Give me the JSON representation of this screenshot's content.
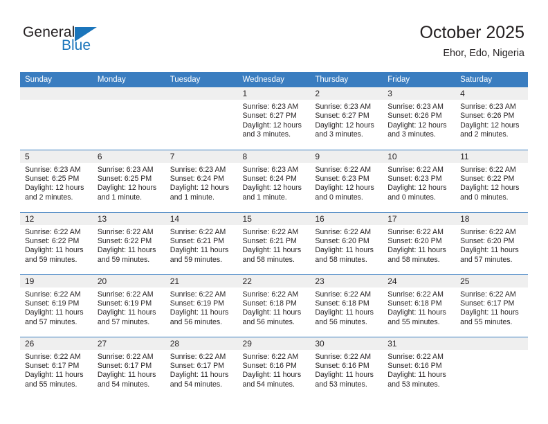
{
  "brand": {
    "name_top": "General",
    "name_bottom": "Blue",
    "accent_color": "#1b75bb"
  },
  "header": {
    "title": "October 2025",
    "location": "Ehor, Edo, Nigeria"
  },
  "theme": {
    "header_row_color": "#3a7dc0",
    "daynum_band_color": "#efefef",
    "text_color": "#231f20"
  },
  "weekdays": [
    "Sunday",
    "Monday",
    "Tuesday",
    "Wednesday",
    "Thursday",
    "Friday",
    "Saturday"
  ],
  "labels": {
    "sunrise_prefix": "Sunrise:",
    "sunset_prefix": "Sunset:",
    "daylight_prefix": "Daylight:"
  },
  "weeks": [
    [
      {
        "day": "",
        "empty": true
      },
      {
        "day": "",
        "empty": true
      },
      {
        "day": "",
        "empty": true
      },
      {
        "day": "1",
        "sunrise": "Sunrise: 6:23 AM",
        "sunset": "Sunset: 6:27 PM",
        "daylight": "Daylight: 12 hours and 3 minutes."
      },
      {
        "day": "2",
        "sunrise": "Sunrise: 6:23 AM",
        "sunset": "Sunset: 6:27 PM",
        "daylight": "Daylight: 12 hours and 3 minutes."
      },
      {
        "day": "3",
        "sunrise": "Sunrise: 6:23 AM",
        "sunset": "Sunset: 6:26 PM",
        "daylight": "Daylight: 12 hours and 3 minutes."
      },
      {
        "day": "4",
        "sunrise": "Sunrise: 6:23 AM",
        "sunset": "Sunset: 6:26 PM",
        "daylight": "Daylight: 12 hours and 2 minutes."
      }
    ],
    [
      {
        "day": "5",
        "sunrise": "Sunrise: 6:23 AM",
        "sunset": "Sunset: 6:25 PM",
        "daylight": "Daylight: 12 hours and 2 minutes."
      },
      {
        "day": "6",
        "sunrise": "Sunrise: 6:23 AM",
        "sunset": "Sunset: 6:25 PM",
        "daylight": "Daylight: 12 hours and 1 minute."
      },
      {
        "day": "7",
        "sunrise": "Sunrise: 6:23 AM",
        "sunset": "Sunset: 6:24 PM",
        "daylight": "Daylight: 12 hours and 1 minute."
      },
      {
        "day": "8",
        "sunrise": "Sunrise: 6:23 AM",
        "sunset": "Sunset: 6:24 PM",
        "daylight": "Daylight: 12 hours and 1 minute."
      },
      {
        "day": "9",
        "sunrise": "Sunrise: 6:22 AM",
        "sunset": "Sunset: 6:23 PM",
        "daylight": "Daylight: 12 hours and 0 minutes."
      },
      {
        "day": "10",
        "sunrise": "Sunrise: 6:22 AM",
        "sunset": "Sunset: 6:23 PM",
        "daylight": "Daylight: 12 hours and 0 minutes."
      },
      {
        "day": "11",
        "sunrise": "Sunrise: 6:22 AM",
        "sunset": "Sunset: 6:22 PM",
        "daylight": "Daylight: 12 hours and 0 minutes."
      }
    ],
    [
      {
        "day": "12",
        "sunrise": "Sunrise: 6:22 AM",
        "sunset": "Sunset: 6:22 PM",
        "daylight": "Daylight: 11 hours and 59 minutes."
      },
      {
        "day": "13",
        "sunrise": "Sunrise: 6:22 AM",
        "sunset": "Sunset: 6:22 PM",
        "daylight": "Daylight: 11 hours and 59 minutes."
      },
      {
        "day": "14",
        "sunrise": "Sunrise: 6:22 AM",
        "sunset": "Sunset: 6:21 PM",
        "daylight": "Daylight: 11 hours and 59 minutes."
      },
      {
        "day": "15",
        "sunrise": "Sunrise: 6:22 AM",
        "sunset": "Sunset: 6:21 PM",
        "daylight": "Daylight: 11 hours and 58 minutes."
      },
      {
        "day": "16",
        "sunrise": "Sunrise: 6:22 AM",
        "sunset": "Sunset: 6:20 PM",
        "daylight": "Daylight: 11 hours and 58 minutes."
      },
      {
        "day": "17",
        "sunrise": "Sunrise: 6:22 AM",
        "sunset": "Sunset: 6:20 PM",
        "daylight": "Daylight: 11 hours and 58 minutes."
      },
      {
        "day": "18",
        "sunrise": "Sunrise: 6:22 AM",
        "sunset": "Sunset: 6:20 PM",
        "daylight": "Daylight: 11 hours and 57 minutes."
      }
    ],
    [
      {
        "day": "19",
        "sunrise": "Sunrise: 6:22 AM",
        "sunset": "Sunset: 6:19 PM",
        "daylight": "Daylight: 11 hours and 57 minutes."
      },
      {
        "day": "20",
        "sunrise": "Sunrise: 6:22 AM",
        "sunset": "Sunset: 6:19 PM",
        "daylight": "Daylight: 11 hours and 57 minutes."
      },
      {
        "day": "21",
        "sunrise": "Sunrise: 6:22 AM",
        "sunset": "Sunset: 6:19 PM",
        "daylight": "Daylight: 11 hours and 56 minutes."
      },
      {
        "day": "22",
        "sunrise": "Sunrise: 6:22 AM",
        "sunset": "Sunset: 6:18 PM",
        "daylight": "Daylight: 11 hours and 56 minutes."
      },
      {
        "day": "23",
        "sunrise": "Sunrise: 6:22 AM",
        "sunset": "Sunset: 6:18 PM",
        "daylight": "Daylight: 11 hours and 56 minutes."
      },
      {
        "day": "24",
        "sunrise": "Sunrise: 6:22 AM",
        "sunset": "Sunset: 6:18 PM",
        "daylight": "Daylight: 11 hours and 55 minutes."
      },
      {
        "day": "25",
        "sunrise": "Sunrise: 6:22 AM",
        "sunset": "Sunset: 6:17 PM",
        "daylight": "Daylight: 11 hours and 55 minutes."
      }
    ],
    [
      {
        "day": "26",
        "sunrise": "Sunrise: 6:22 AM",
        "sunset": "Sunset: 6:17 PM",
        "daylight": "Daylight: 11 hours and 55 minutes."
      },
      {
        "day": "27",
        "sunrise": "Sunrise: 6:22 AM",
        "sunset": "Sunset: 6:17 PM",
        "daylight": "Daylight: 11 hours and 54 minutes."
      },
      {
        "day": "28",
        "sunrise": "Sunrise: 6:22 AM",
        "sunset": "Sunset: 6:17 PM",
        "daylight": "Daylight: 11 hours and 54 minutes."
      },
      {
        "day": "29",
        "sunrise": "Sunrise: 6:22 AM",
        "sunset": "Sunset: 6:16 PM",
        "daylight": "Daylight: 11 hours and 54 minutes."
      },
      {
        "day": "30",
        "sunrise": "Sunrise: 6:22 AM",
        "sunset": "Sunset: 6:16 PM",
        "daylight": "Daylight: 11 hours and 53 minutes."
      },
      {
        "day": "31",
        "sunrise": "Sunrise: 6:22 AM",
        "sunset": "Sunset: 6:16 PM",
        "daylight": "Daylight: 11 hours and 53 minutes."
      },
      {
        "day": "",
        "empty": true
      }
    ]
  ]
}
